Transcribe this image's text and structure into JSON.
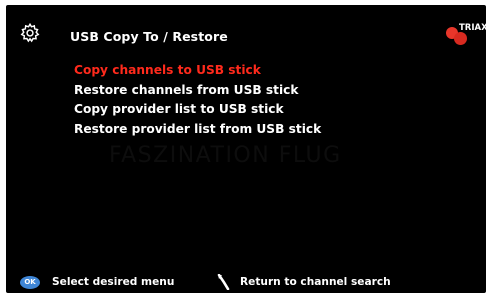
{
  "header": {
    "title": "USB Copy To / Restore",
    "gear_icon": "gear-icon",
    "brand": "TRIAX"
  },
  "menu": {
    "selected_index": 0,
    "items": [
      {
        "label": "Copy channels to USB stick"
      },
      {
        "label": "Restore channels from USB stick"
      },
      {
        "label": "Copy provider list to USB stick"
      },
      {
        "label": "Restore provider list from USB stick"
      }
    ]
  },
  "watermark": "FASZINATION FLUG",
  "footer": {
    "ok_label": "OK",
    "hint_select": "Select desired menu",
    "hint_return": "Return to channel search",
    "return_icon": "back-arrow-icon"
  },
  "colors": {
    "background": "#000000",
    "text": "#ffffff",
    "selected": "#ff2a1c",
    "ok_button": "#3f86d6",
    "logo_red": "#e8362a"
  }
}
